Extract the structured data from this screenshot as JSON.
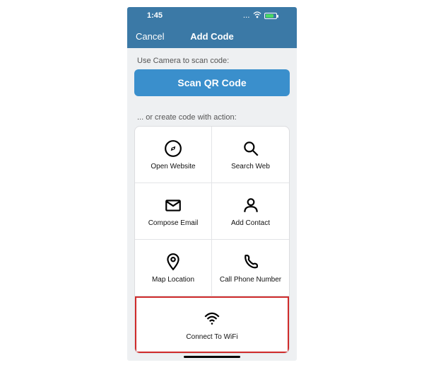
{
  "status": {
    "time": "1:45",
    "signal": "...",
    "battery_charging": true
  },
  "nav": {
    "cancel": "Cancel",
    "title": "Add Code"
  },
  "scan": {
    "hint": "Use Camera to scan code:",
    "button": "Scan QR Code"
  },
  "create": {
    "hint": "... or create code with action:",
    "actions": {
      "open_website": "Open Website",
      "search_web": "Search Web",
      "compose_email": "Compose Email",
      "add_contact": "Add Contact",
      "map_location": "Map Location",
      "call_phone": "Call Phone Number",
      "connect_wifi": "Connect To WiFi"
    }
  },
  "highlighted_action": "connect_wifi"
}
